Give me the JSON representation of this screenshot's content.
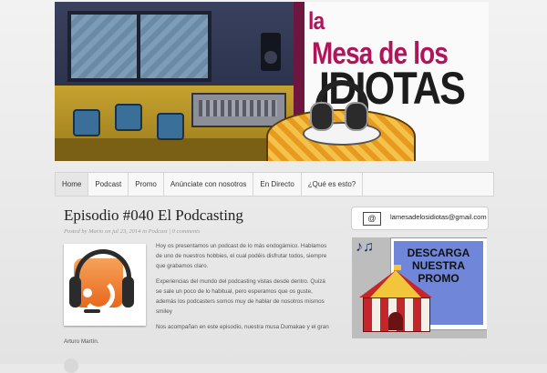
{
  "header": {
    "brand_line1": "la",
    "brand_line2": "Mesa de los",
    "brand_line3": "IDIOTAS"
  },
  "nav": {
    "items": [
      {
        "label": "Home",
        "active": true
      },
      {
        "label": "Podcast",
        "active": false
      },
      {
        "label": "Promo",
        "active": false
      },
      {
        "label": "Anúnciate con nosotros",
        "active": false
      },
      {
        "label": "En Directo",
        "active": false
      },
      {
        "label": "¿Qué es esto?",
        "active": false
      }
    ]
  },
  "post": {
    "title": "Episodio #040 El Podcasting",
    "meta_prefix": "Posted by",
    "author": "Mario",
    "meta_on": "on",
    "date": "jul 23, 2014",
    "meta_in": "in",
    "category": "Podcast",
    "meta_sep": " | ",
    "comments": "0 comments",
    "paragraphs": [
      "Hoy os presentamos un podcast de lo más endogámico. Hablamos de uno de nuestros hobbies, el cual podéis disfrutar todos, siempre que grabamos claro.",
      "Experiencias del mundo del podcasting vistas desde dentro. Quizá se sale un poco de lo habitual, pero esperamos que os guste, además los podcasters somos muy de hablar de nosotros mismos smiley",
      "Nos acompañan en este episodio, nuestra musa Dumakae y el gran"
    ],
    "tail": "Arturo Martín."
  },
  "sidebar": {
    "email": "lamesadelosidiotas@gmail.com",
    "mail_icon_glyph": "@",
    "promo_text": "DESCARGA NUESTRA PROMO",
    "notes_glyph": "♪♫"
  },
  "colors": {
    "brand_magenta": "#b0155a",
    "promo_blue": "#6f86d9",
    "rss_orange": "#e8681b"
  },
  "icons": [
    "mail-icon",
    "rss-icon",
    "headphones-icon",
    "music-notes-icon",
    "circus-tent-icon"
  ]
}
